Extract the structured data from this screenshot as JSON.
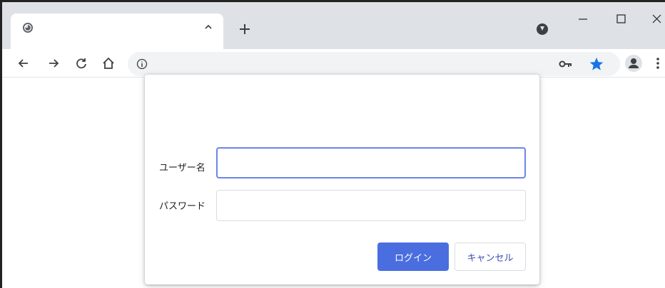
{
  "browser": {
    "tab": {
      "title": ""
    },
    "omnibox": {
      "url": ""
    },
    "colors": {
      "tabstrip": "#dee1e6",
      "star": "#1a73e8",
      "accent": "#4a6ee0"
    }
  },
  "dialog": {
    "title": "",
    "username_label": "ユーザー名",
    "username_value": "",
    "password_label": "パスワード",
    "password_value": "",
    "login_label": "ログイン",
    "cancel_label": "キャンセル"
  }
}
